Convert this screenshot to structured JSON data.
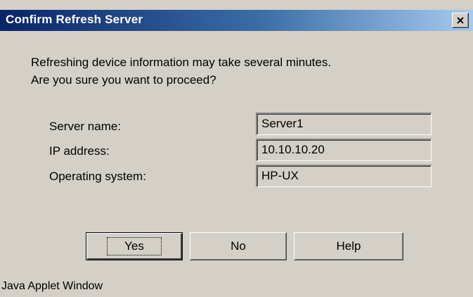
{
  "window": {
    "title": "Confirm Refresh Server",
    "close_icon": "close-icon"
  },
  "message": {
    "line1": "Refreshing device information may take several minutes.",
    "line2": "Are you sure you want to proceed?"
  },
  "fields": [
    {
      "label": "Server name:",
      "value": "Server1"
    },
    {
      "label": "IP address:",
      "value": "10.10.10.20"
    },
    {
      "label": "Operating system:",
      "value": "HP-UX"
    }
  ],
  "buttons": {
    "yes": "Yes",
    "no": "No",
    "help": "Help"
  },
  "footer": "Java Applet Window",
  "colors": {
    "background": "#d4d0c8",
    "titlebar_start": "#0a246a",
    "titlebar_end": "#a6caf0",
    "title_text": "#ffffff"
  }
}
